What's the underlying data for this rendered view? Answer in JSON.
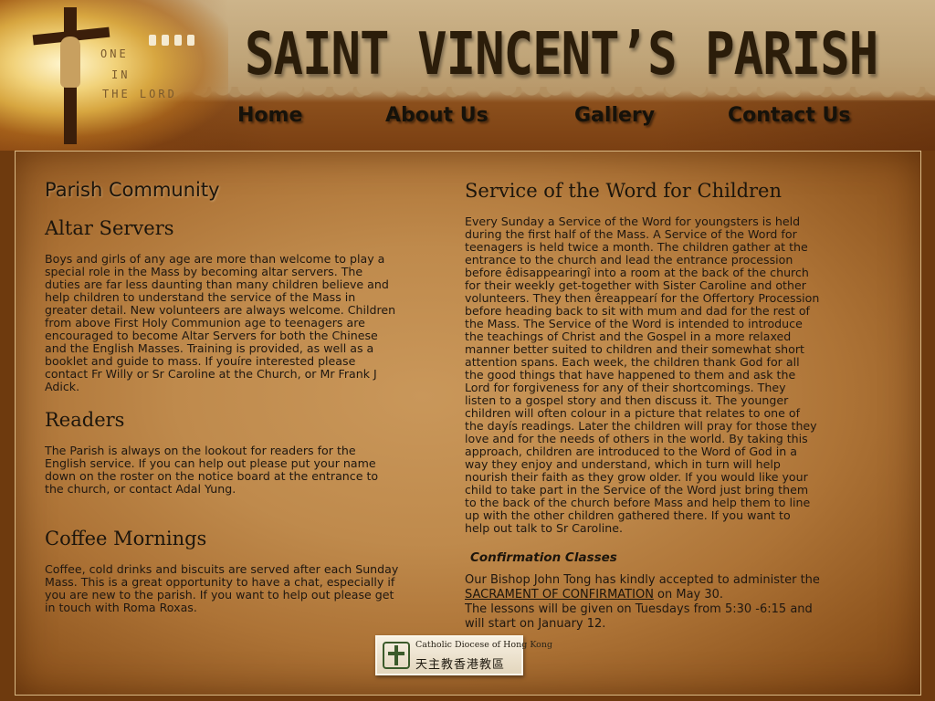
{
  "header": {
    "site_title": "SAINT VINCENT’S PARISH",
    "motto": [
      "ONE",
      "IN",
      "THE LORD"
    ]
  },
  "nav": {
    "items": [
      {
        "label": "Home"
      },
      {
        "label": "About Us"
      },
      {
        "label": "Gallery"
      },
      {
        "label": "Contact Us"
      }
    ]
  },
  "left_column": {
    "section_title": "Parish Community",
    "altar_servers": {
      "title": "Altar Servers",
      "lines": [
        "Boys and girls of any age are more than welcome to play a",
        "special role in the Mass by becoming altar servers. The",
        "duties are far less daunting than many children believe and",
        "help children to understand the service of the Mass in",
        "greater detail. New volunteers are always welcome. Children",
        "from above First Holy Communion age to teenagers are",
        "encouraged to become Altar Servers for both the Chinese",
        "and the English Masses. Training is provided, as well as a",
        "booklet and guide to mass. If youíre interested please",
        "contact Fr Willy or Sr Caroline at the Church, or Mr Frank J",
        "Adick."
      ]
    },
    "readers": {
      "title": "Readers",
      "lines": [
        "The Parish is always on the lookout for readers for the",
        "English service. If you can help out please put your name",
        "down on the roster on the notice board at the entrance to",
        "the church, or contact Adal Yung."
      ]
    },
    "coffee_mornings": {
      "title": "Coffee Mornings",
      "lines": [
        "Coffee, cold drinks and biscuits are served after each Sunday",
        "Mass. This is a great opportunity to have a chat, especially if",
        "you are new to the parish. If you want to help out please get",
        "in touch with Roma Roxas."
      ]
    }
  },
  "right_column": {
    "service_word": {
      "title": "Service of the Word for Children",
      "lines": [
        "Every Sunday a Service of the Word for youngsters is held",
        "during the first half of the Mass. A Service of the Word for",
        "teenagers is held twice a month. The children gather at the",
        "entrance to the church and lead the entrance procession",
        "before êdisappearingî into a room at the back of the church",
        "for their weekly get-together with Sister Caroline and other",
        "volunteers. They then êreappearí for the Offertory Procession",
        "before heading back to sit with mum and dad for the rest of",
        "the Mass. The Service of the Word is intended to introduce",
        "the teachings of Christ and the Gospel in a more relaxed",
        "manner better suited to children and their somewhat short",
        "attention spans. Each week, the children thank God for all",
        "the good things that have happened to them and ask the",
        "Lord for forgiveness for any of their shortcomings. They",
        "listen to a gospel story and then discuss it. The younger",
        "children will often colour in a picture that relates to one of",
        "the dayís readings. Later the children will pray for those they",
        "love and for the needs of others in the world. By taking this",
        "approach, children are introduced to the Word of God in a",
        "way they enjoy and understand, which in turn will help",
        "nourish their faith as they grow older.  If you would like your",
        "child to take part in the Service of the Word just bring them",
        "to the back of the church before Mass and help them to line",
        "up with the other children gathered there. If you want to",
        "help out talk to Sr Caroline."
      ]
    },
    "confirmation": {
      "title": "Confirmation Classes",
      "line1_prefix": "Our Bishop John Tong has kindly accepted to administer the",
      "link_text": "SACRAMENT OF CONFIRMATION",
      "line2_suffix": " on May 30.",
      "line3": "The lessons will be given on Tuesdays from 5:30 -6:15 and",
      "line4": "will start on January 12."
    }
  },
  "footer": {
    "logo_en": "Catholic Diocese of Hong Kong",
    "logo_zh": "天主教香港教區"
  }
}
